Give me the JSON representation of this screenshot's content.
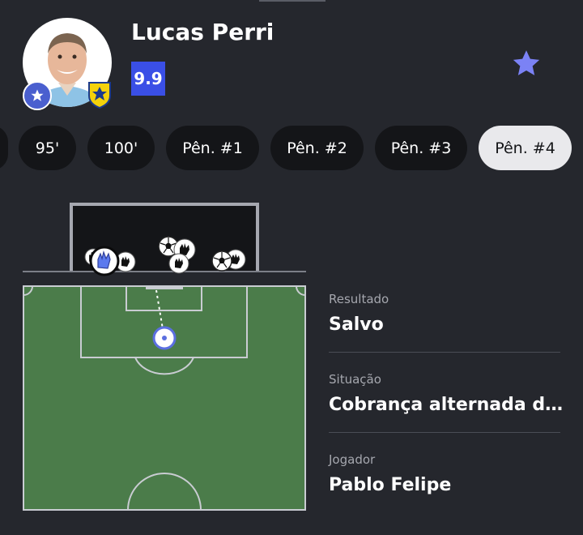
{
  "player": {
    "name": "Lucas Perri",
    "rating": "9.9",
    "rating_color": "#3a4fe6",
    "avatar_icon": "player-photo",
    "badge_icon": "star-badge-icon",
    "club_icon": "club-crest-icon",
    "favorite_icon": "star-icon",
    "favorite_color": "#7b82f5"
  },
  "periods": {
    "items": [
      {
        "label": ""
      },
      {
        "label": "95'"
      },
      {
        "label": "100'"
      },
      {
        "label": "Pên. #1"
      },
      {
        "label": "Pên. #2"
      },
      {
        "label": "Pên. #3"
      },
      {
        "label": "Pên. #4"
      }
    ],
    "selected": "Pên. #4"
  },
  "shot_map": {
    "pitch_color": "#4b7c4a",
    "goal_markers": [
      "ball-icon",
      "glove-icon",
      "glove-icon-highlighted"
    ],
    "selected_marker": "glove-icon-highlighted"
  },
  "details": {
    "result_label": "Resultado",
    "result_value": "Salvo",
    "situation_label": "Situação",
    "situation_value": "Cobrança alternada de pênaltis",
    "player_label": "Jogador",
    "player_value": "Pablo Felipe"
  }
}
